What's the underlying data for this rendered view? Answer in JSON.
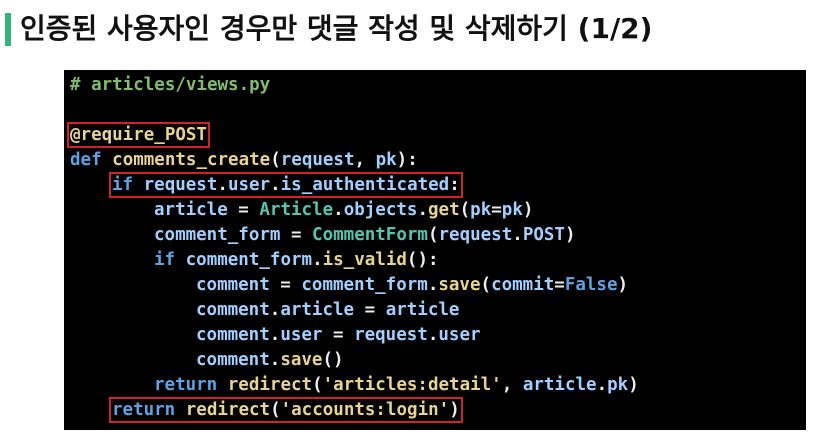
{
  "title": "인증된 사용자인 경우만 댓글 작성 및 삭제하기 (1/2)",
  "colors": {
    "accent": "#2fb57a",
    "code_background": "#000000",
    "highlight_box": "#d32222"
  },
  "code": {
    "lines": [
      {
        "indent": 0,
        "highlight": false,
        "tokens": [
          [
            "comment",
            "# articles/views.py"
          ]
        ]
      },
      {
        "indent": 0,
        "highlight": false,
        "tokens": []
      },
      {
        "indent": 0,
        "highlight": true,
        "tokens": [
          [
            "decorator",
            "@require_POST"
          ]
        ]
      },
      {
        "indent": 0,
        "highlight": false,
        "tokens": [
          [
            "keyword",
            "def"
          ],
          [
            "default",
            " "
          ],
          [
            "func",
            "comments_create"
          ],
          [
            "default",
            "("
          ],
          [
            "param",
            "request"
          ],
          [
            "default",
            ", "
          ],
          [
            "param",
            "pk"
          ],
          [
            "default",
            "):"
          ]
        ]
      },
      {
        "indent": 1,
        "highlight": true,
        "tokens": [
          [
            "keyword",
            "if"
          ],
          [
            "default",
            " "
          ],
          [
            "param",
            "request"
          ],
          [
            "default",
            "."
          ],
          [
            "attr",
            "user"
          ],
          [
            "default",
            "."
          ],
          [
            "attr",
            "is_authenticated"
          ],
          [
            "default",
            ":"
          ]
        ]
      },
      {
        "indent": 2,
        "highlight": false,
        "tokens": [
          [
            "param",
            "article"
          ],
          [
            "default",
            " = "
          ],
          [
            "class",
            "Article"
          ],
          [
            "default",
            "."
          ],
          [
            "attr",
            "objects"
          ],
          [
            "default",
            "."
          ],
          [
            "func",
            "get"
          ],
          [
            "default",
            "("
          ],
          [
            "param",
            "pk"
          ],
          [
            "default",
            "="
          ],
          [
            "param",
            "pk"
          ],
          [
            "default",
            ")"
          ]
        ]
      },
      {
        "indent": 2,
        "highlight": false,
        "tokens": [
          [
            "param",
            "comment_form"
          ],
          [
            "default",
            " = "
          ],
          [
            "class",
            "CommentForm"
          ],
          [
            "default",
            "("
          ],
          [
            "param",
            "request"
          ],
          [
            "default",
            "."
          ],
          [
            "attr",
            "POST"
          ],
          [
            "default",
            ")"
          ]
        ]
      },
      {
        "indent": 2,
        "highlight": false,
        "tokens": [
          [
            "keyword",
            "if"
          ],
          [
            "default",
            " "
          ],
          [
            "param",
            "comment_form"
          ],
          [
            "default",
            "."
          ],
          [
            "func",
            "is_valid"
          ],
          [
            "default",
            "():"
          ]
        ]
      },
      {
        "indent": 3,
        "highlight": false,
        "tokens": [
          [
            "param",
            "comment"
          ],
          [
            "default",
            " = "
          ],
          [
            "param",
            "comment_form"
          ],
          [
            "default",
            "."
          ],
          [
            "func",
            "save"
          ],
          [
            "default",
            "("
          ],
          [
            "param",
            "commit"
          ],
          [
            "default",
            "="
          ],
          [
            "const",
            "False"
          ],
          [
            "default",
            ")"
          ]
        ]
      },
      {
        "indent": 3,
        "highlight": false,
        "tokens": [
          [
            "param",
            "comment"
          ],
          [
            "default",
            "."
          ],
          [
            "attr",
            "article"
          ],
          [
            "default",
            " = "
          ],
          [
            "param",
            "article"
          ]
        ]
      },
      {
        "indent": 3,
        "highlight": false,
        "tokens": [
          [
            "param",
            "comment"
          ],
          [
            "default",
            "."
          ],
          [
            "attr",
            "user"
          ],
          [
            "default",
            " = "
          ],
          [
            "param",
            "request"
          ],
          [
            "default",
            "."
          ],
          [
            "attr",
            "user"
          ]
        ]
      },
      {
        "indent": 3,
        "highlight": false,
        "tokens": [
          [
            "param",
            "comment"
          ],
          [
            "default",
            "."
          ],
          [
            "func",
            "save"
          ],
          [
            "default",
            "()"
          ]
        ]
      },
      {
        "indent": 2,
        "highlight": false,
        "tokens": [
          [
            "keyword",
            "return"
          ],
          [
            "default",
            " "
          ],
          [
            "func",
            "redirect"
          ],
          [
            "default",
            "("
          ],
          [
            "string",
            "'articles:detail'"
          ],
          [
            "default",
            ", "
          ],
          [
            "param",
            "article"
          ],
          [
            "default",
            "."
          ],
          [
            "attr",
            "pk"
          ],
          [
            "default",
            ")"
          ]
        ]
      },
      {
        "indent": 1,
        "highlight": true,
        "tokens": [
          [
            "keyword",
            "return"
          ],
          [
            "default",
            " "
          ],
          [
            "func",
            "redirect"
          ],
          [
            "default",
            "("
          ],
          [
            "string",
            "'accounts:login'"
          ],
          [
            "default",
            ")"
          ]
        ]
      }
    ]
  }
}
